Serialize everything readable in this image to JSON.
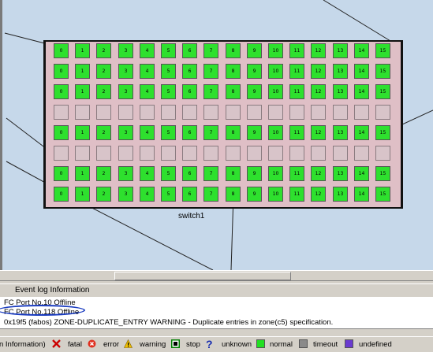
{
  "switch": {
    "label": "switch1",
    "rows": [
      {
        "online": true
      },
      {
        "online": true
      },
      {
        "online": true
      },
      {
        "online": false
      },
      {
        "online": true
      },
      {
        "online": false
      },
      {
        "online": true
      },
      {
        "online": true
      }
    ],
    "row_numbers": [
      [
        "0",
        "1",
        "2",
        "3",
        "4",
        "5",
        "6",
        "7",
        "8",
        "9",
        "10",
        "11",
        "12",
        "13",
        "14",
        "15"
      ],
      [
        "0",
        "1",
        "2",
        "3",
        "4",
        "5",
        "6",
        "7",
        "8",
        "9",
        "10",
        "11",
        "12",
        "13",
        "14",
        "15"
      ],
      [
        "0",
        "1",
        "2",
        "3",
        "4",
        "5",
        "6",
        "7",
        "8",
        "9",
        "10",
        "11",
        "12",
        "13",
        "14",
        "15"
      ],
      [
        "",
        "",
        "",
        "",
        "",
        "",
        "",
        "",
        "",
        "",
        "",
        "",
        "",
        "",
        "",
        ""
      ],
      [
        "0",
        "1",
        "2",
        "3",
        "4",
        "5",
        "6",
        "7",
        "8",
        "9",
        "10",
        "11",
        "12",
        "13",
        "14",
        "15"
      ],
      [
        "",
        "",
        "",
        "",
        "",
        "",
        "",
        "",
        "",
        "",
        "",
        "",
        "",
        "",
        "",
        ""
      ],
      [
        "0",
        "1",
        "2",
        "3",
        "4",
        "5",
        "6",
        "7",
        "8",
        "9",
        "10",
        "11",
        "12",
        "13",
        "14",
        "15"
      ],
      [
        "0",
        "1",
        "2",
        "3",
        "4",
        "5",
        "6",
        "7",
        "8",
        "9",
        "10",
        "11",
        "12",
        "13",
        "14",
        "15"
      ]
    ]
  },
  "event_log": {
    "title": "Event log Information",
    "entries": [
      "FC Port No.10 Offline",
      "FC Port No.118 Offline",
      "0x19f5 (fabos) ZONE-DUPLICATE_ENTRY WARNING - Duplicate entries in zone(c5) specification."
    ]
  },
  "legend": {
    "prefix": "n Information)",
    "items": [
      {
        "label": "fatal",
        "icon": "x-icon",
        "color": "#cc0000"
      },
      {
        "label": "error",
        "icon": "error-icon",
        "color": "#e03020"
      },
      {
        "label": "warning",
        "icon": "warning-icon",
        "color": "#f0c000"
      },
      {
        "label": "stop",
        "icon": "stop-icon",
        "color": "#008000"
      },
      {
        "label": "unknown",
        "icon": "question-icon",
        "color": "#1a2fb0"
      },
      {
        "label": "normal",
        "icon": "normal-square",
        "color": "#22e022"
      },
      {
        "label": "timeout",
        "icon": "timeout-square",
        "color": "#8a8a8a"
      },
      {
        "label": "undefined",
        "icon": "undefined-square",
        "color": "#6a3ad0"
      }
    ]
  }
}
